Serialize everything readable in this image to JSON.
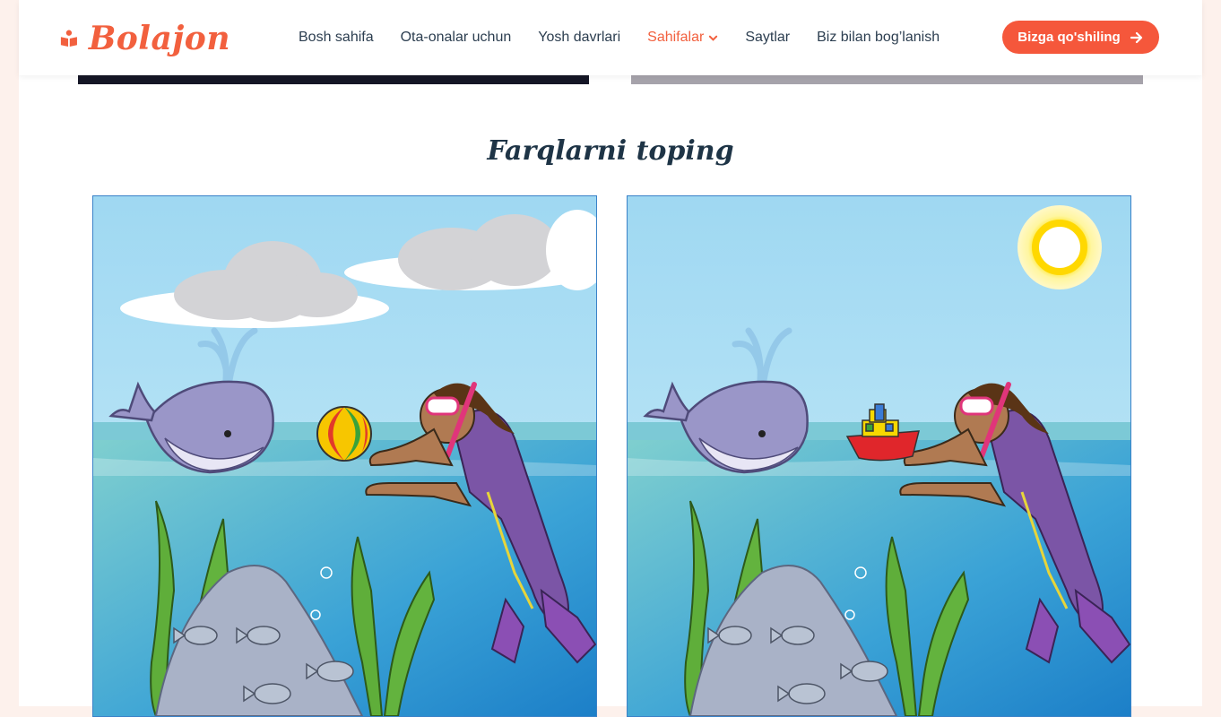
{
  "brand": {
    "name": "Bolajon",
    "color": "#f2603e"
  },
  "nav": {
    "items": [
      {
        "label": "Bosh sahifa"
      },
      {
        "label": "Ota-onalar uchun"
      },
      {
        "label": "Yosh davrlari"
      },
      {
        "label": "Sahifalar",
        "active": true,
        "has_dropdown": true
      },
      {
        "label": "Saytlar"
      },
      {
        "label": "Biz bilan bog’lanish"
      }
    ]
  },
  "cta": {
    "label": "Bizga qo'shiling",
    "icon": "arrow-right-icon"
  },
  "section": {
    "title": "Farqlarni toping"
  },
  "puzzle": {
    "left_image": {
      "floating_object": "ball",
      "sun": false
    },
    "right_image": {
      "floating_object": "boat",
      "sun": true
    }
  }
}
